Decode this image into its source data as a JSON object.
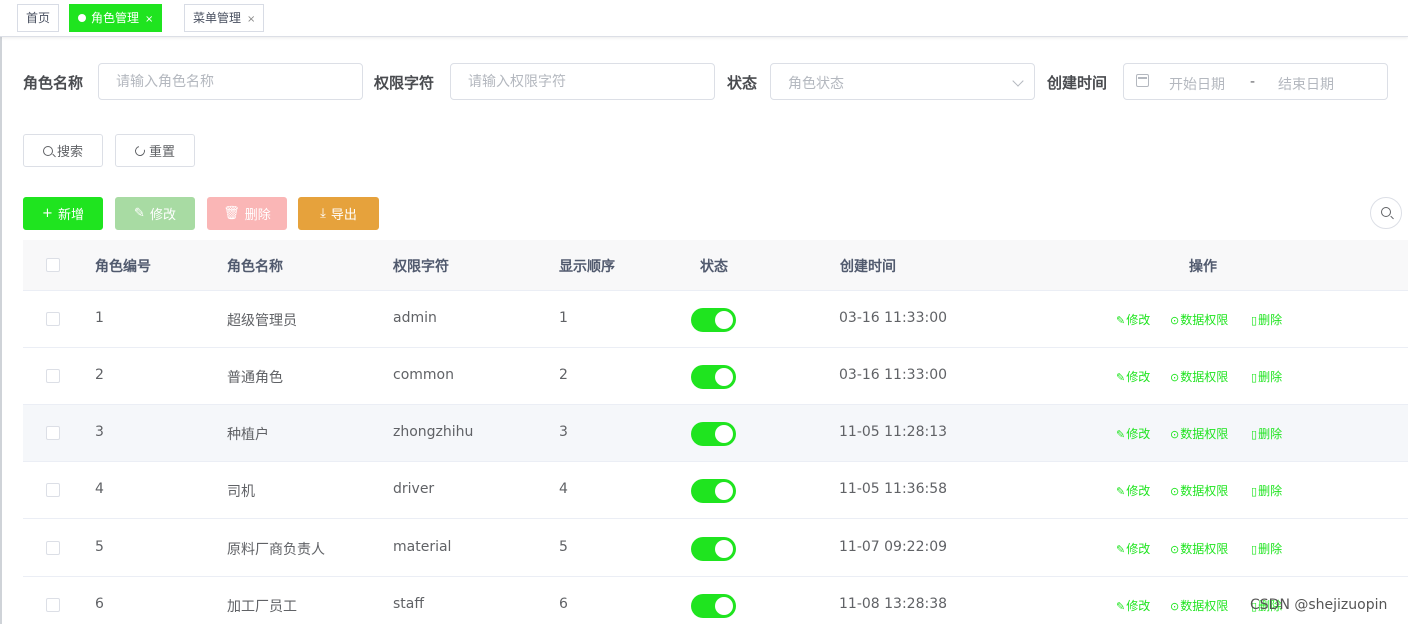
{
  "tabs": [
    {
      "label": "首页",
      "active": false,
      "closable": false
    },
    {
      "label": "角色管理",
      "active": true,
      "closable": true
    },
    {
      "label": "菜单管理",
      "active": false,
      "closable": true
    }
  ],
  "tab_close_glyph": "×",
  "form": {
    "role_name_label": "角色名称",
    "role_name_placeholder": "请输入角色名称",
    "perm_label": "权限字符",
    "perm_placeholder": "请输入权限字符",
    "status_label": "状态",
    "status_placeholder": "角色状态",
    "created_label": "创建时间",
    "start_placeholder": "开始日期",
    "range_separator": "-",
    "end_placeholder": "结束日期"
  },
  "buttons": {
    "search": "搜索",
    "reset": "重置",
    "add": "新增",
    "edit": "修改",
    "delete": "删除",
    "export": "导出"
  },
  "table": {
    "headers": [
      "角色编号",
      "角色名称",
      "权限字符",
      "显示顺序",
      "状态",
      "创建时间",
      "操作"
    ],
    "ops": [
      "修改",
      "数据权限",
      "删除"
    ],
    "rows": [
      {
        "id": "1",
        "name": "超级管理员",
        "key": "admin",
        "sort": "1",
        "enabled": true,
        "created": "03-16 11:33:00"
      },
      {
        "id": "2",
        "name": "普通角色",
        "key": "common",
        "sort": "2",
        "enabled": true,
        "created": "03-16 11:33:00"
      },
      {
        "id": "3",
        "name": "种植户",
        "key": "zhongzhihu",
        "sort": "3",
        "enabled": true,
        "created": "11-05 11:28:13"
      },
      {
        "id": "4",
        "name": "司机",
        "key": "driver",
        "sort": "4",
        "enabled": true,
        "created": "11-05 11:36:58"
      },
      {
        "id": "5",
        "name": "原料厂商负责人",
        "key": "material",
        "sort": "5",
        "enabled": true,
        "created": "11-07 09:22:09"
      },
      {
        "id": "6",
        "name": "加工厂员工",
        "key": "staff",
        "sort": "6",
        "enabled": true,
        "created": "11-08 13:28:38"
      }
    ]
  },
  "watermark": "CSDN @shejizuopin",
  "colors": {
    "primary": "#1fe41f",
    "warning": "#e6a23c",
    "danger_light": "#fab6b6",
    "primary_light": "#a8dba3"
  }
}
